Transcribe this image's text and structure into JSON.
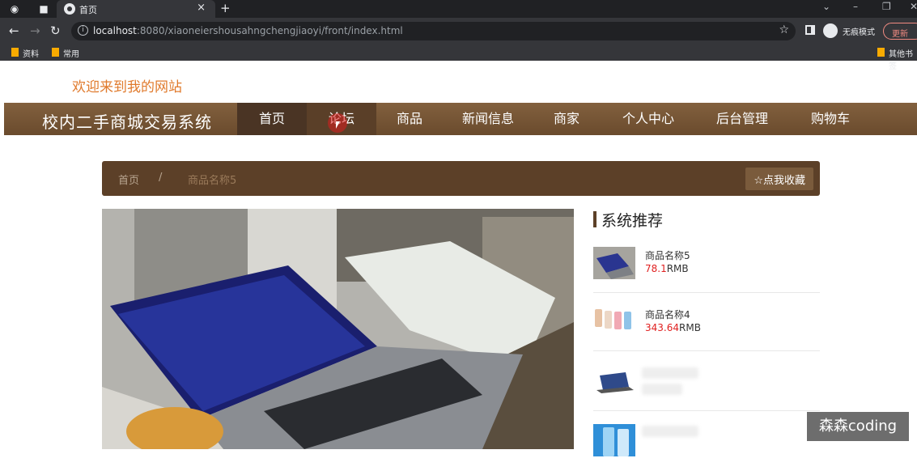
{
  "browser": {
    "tab_title": "首页",
    "tab_close": "×",
    "new_tab": "+",
    "url_host": "localhost",
    "url_rest": ":8080/xiaoneiershousahngchengjiaoyi/front/index.html",
    "profile_label": "无痕模式",
    "update_label": "更新",
    "bookmarks": [
      "资料",
      "常用"
    ],
    "other_bookmarks": "其他书签"
  },
  "site": {
    "welcome": "欢迎来到我的网站",
    "title": "校内二手商城交易系统"
  },
  "nav": {
    "items": [
      "首页",
      "论坛",
      "商品",
      "新闻信息",
      "商家",
      "个人中心",
      "后台管理",
      "购物车"
    ],
    "active": "首页",
    "hovered": "论坛"
  },
  "breadcrumb": {
    "home": "首页",
    "separator": "/",
    "current": "商品名称5",
    "favorite_button": "☆点我收藏"
  },
  "recommend": {
    "heading": "系统推荐",
    "items": [
      {
        "name": "商品名称5",
        "price": "78.1",
        "unit": "RMB"
      },
      {
        "name": "商品名称4",
        "price": "343.64",
        "unit": "RMB"
      }
    ]
  },
  "watermark": "森森coding",
  "colors": {
    "nav_bg": "#7a5a3a",
    "nav_active": "#4a3424",
    "breadcrumb_bg": "#5c4028",
    "welcome": "#e07a2c",
    "price": "#e02020"
  }
}
